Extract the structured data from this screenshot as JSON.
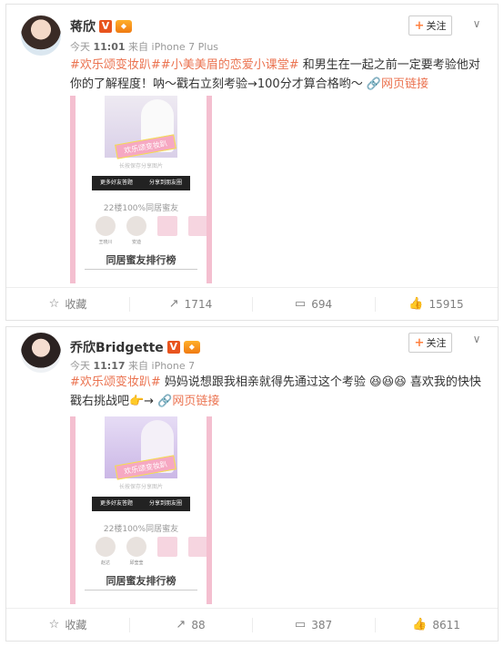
{
  "posts": [
    {
      "user": {
        "name": "蒋欣"
      },
      "badge_v": "V",
      "meta": {
        "prefix": "今天",
        "time": "11:01",
        "source": "来自 iPhone 7 Plus"
      },
      "follow_label": "关注",
      "text": {
        "topic1": "#欢乐颂变妆趴#",
        "topic2": "#小美美眉的恋爱小课堂#",
        "body": " 和男生在一起之前一定要考验他对你的了解程度！呐～戳右立刻考验→100分才算合格哟～ ",
        "link_label": "网页链接"
      },
      "thumb": {
        "ribbon": "欢乐颂变妆趴",
        "hint": "长按保存分享图片",
        "btn_left": "更多好友答题",
        "btn_right": "分享到朋友圈",
        "percent": "22楼100%同居蜜友",
        "friends": [
          "王晓川",
          "安迪"
        ],
        "rank": "同居蜜友排行榜"
      },
      "actions": {
        "collect": "收藏",
        "repost": "1714",
        "comment": "694",
        "like": "15915"
      }
    },
    {
      "user": {
        "name": "乔欣Bridgette"
      },
      "badge_v": "V",
      "meta": {
        "prefix": "今天",
        "time": "11:17",
        "source": "来自 iPhone 7"
      },
      "follow_label": "关注",
      "text": {
        "topic1": "#欢乐颂变妆趴#",
        "body": " 妈妈说想跟我相亲就得先通过这个考验 😆😆😆 喜欢我的快快戳右挑战吧👉→ ",
        "link_label": "网页链接"
      },
      "thumb": {
        "ribbon": "欢乐颂变妆趴",
        "hint": "长按保存分享图片",
        "btn_left": "更多好友答题",
        "btn_right": "分享到朋友圈",
        "percent": "22楼100%同居蜜友",
        "friends": [
          "赵达",
          "邱莹莹"
        ],
        "rank": "同居蜜友排行榜"
      },
      "actions": {
        "collect": "收藏",
        "repost": "88",
        "comment": "387",
        "like": "8611"
      }
    }
  ],
  "colors": {
    "topic": "#eb7350",
    "vbadge": "#e8541e",
    "thumb_border": "#f4bfd0"
  }
}
